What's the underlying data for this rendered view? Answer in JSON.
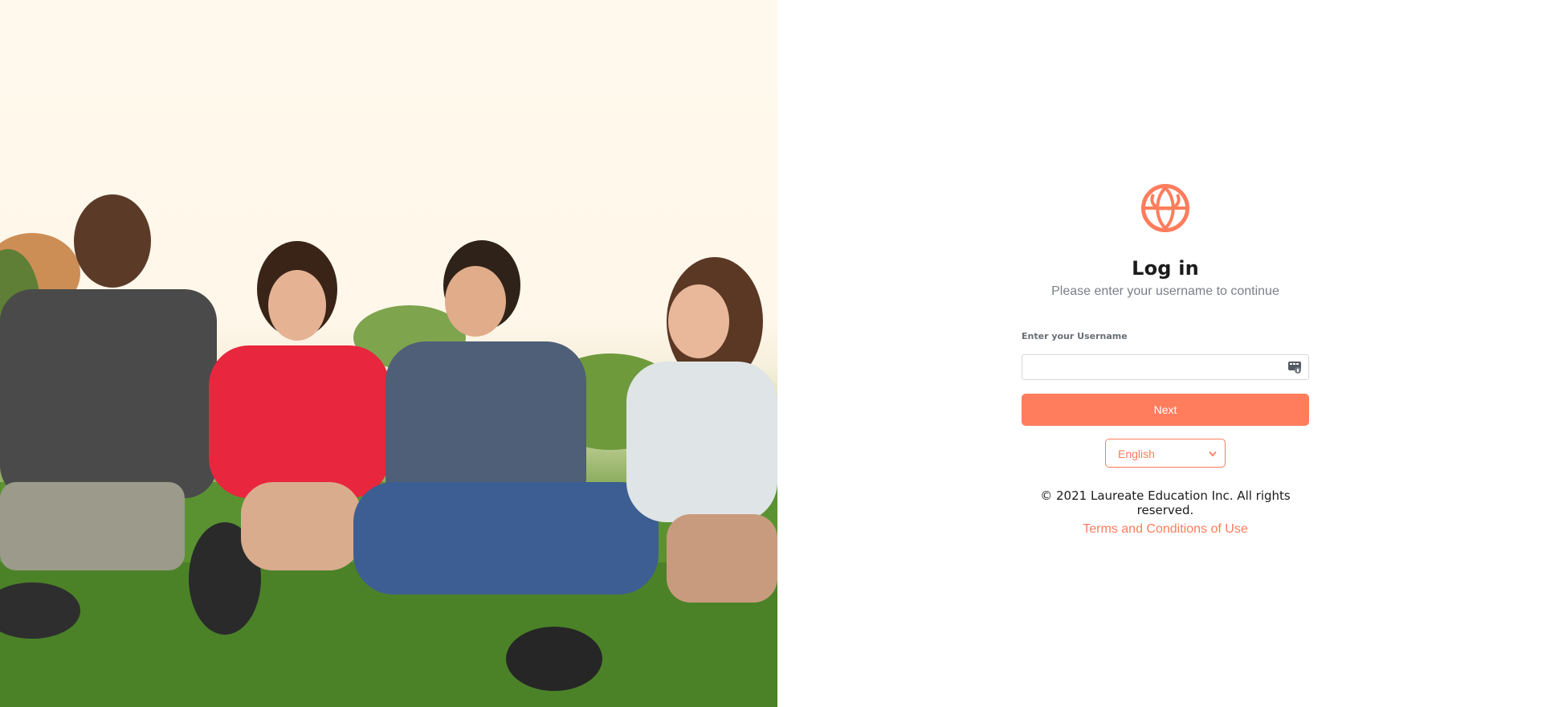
{
  "hero": {
    "image": "photo-four-friends-sitting-on-grass"
  },
  "login": {
    "logo_icon": "globe-leaf-logo-icon",
    "title": "Log in",
    "subtitle": "Please enter your username to continue",
    "username_label": "Enter your Username",
    "username_value": "",
    "username_icon": "password-manager-key-icon",
    "next_label": "Next",
    "language": {
      "selected": "English"
    },
    "copyright": "© 2021 Laureate Education Inc. All rights reserved.",
    "terms_link": "Terms and Conditions of Use"
  },
  "colors": {
    "accent": "#ff7d5c",
    "subtitle": "#7a7f87",
    "text": "#1c1c1c"
  }
}
